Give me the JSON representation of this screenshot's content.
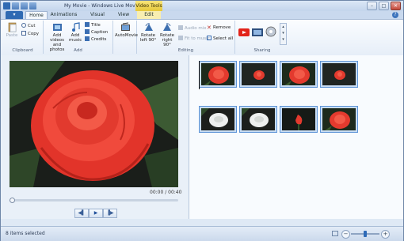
{
  "window": {
    "title": "My Movie - Windows Live Movie Maker",
    "context_title": "Video Tools",
    "controls": {
      "minimize": "–",
      "maximize": "□",
      "close": "✕"
    }
  },
  "tabs": [
    {
      "label": "Home",
      "selected": true
    },
    {
      "label": "Animations"
    },
    {
      "label": "Visual Effects"
    },
    {
      "label": "View"
    },
    {
      "label": "Edit",
      "contextual": true
    }
  ],
  "ribbon": {
    "clipboard": {
      "label": "Clipboard",
      "paste": "Paste",
      "cut": "Cut",
      "copy": "Copy"
    },
    "add": {
      "label": "Add",
      "add_videos_line1": "Add videos",
      "add_videos_line2": "and photos",
      "add_music_line1": "Add",
      "add_music_line2": "music",
      "title": "Title",
      "caption": "Caption",
      "credits": "Credits"
    },
    "automovie": {
      "label": "AutoMovie"
    },
    "editing": {
      "label": "Editing",
      "rotate_left_line1": "Rotate",
      "rotate_left_line2": "left 90°",
      "rotate_right_line1": "Rotate",
      "rotate_right_line2": "right 90°",
      "audio_mix": "Audio mix",
      "fit_to_music": "Fit to music",
      "remove": "Remove",
      "select_all": "Select all"
    },
    "sharing": {
      "label": "Sharing"
    }
  },
  "preview": {
    "timecode": "00:00 / 00:40",
    "progress": 0
  },
  "storyboard": {
    "clips": [
      {
        "kind": "red-rose"
      },
      {
        "kind": "red-rose-small"
      },
      {
        "kind": "red-rose"
      },
      {
        "kind": "red-rose-small"
      },
      {
        "kind": "white-rose"
      },
      {
        "kind": "white-rose"
      },
      {
        "kind": "red-bud"
      },
      {
        "kind": "red-rose"
      }
    ]
  },
  "status": {
    "text": "8 items selected"
  },
  "colors": {
    "accent": "#2f6ab3",
    "context": "#f3dc62",
    "rose": "#e8372c"
  }
}
